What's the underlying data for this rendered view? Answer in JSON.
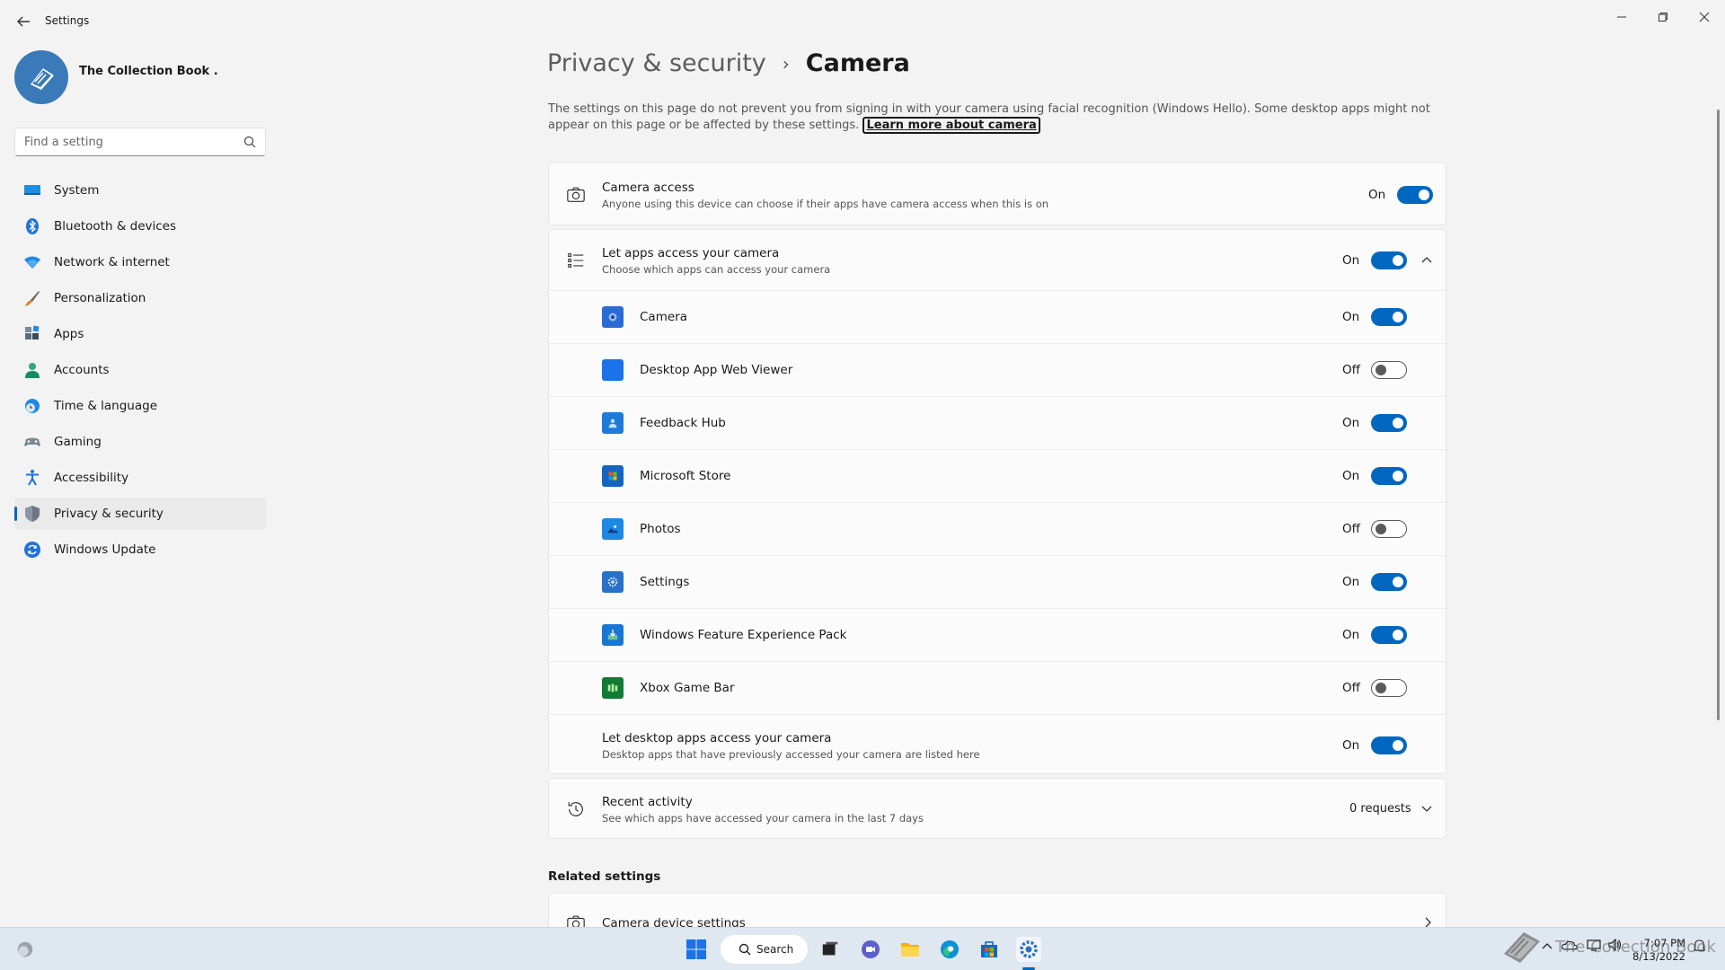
{
  "window": {
    "title": "Settings"
  },
  "profile": {
    "name": "The Collection Book ."
  },
  "search": {
    "placeholder": "Find a setting"
  },
  "sidebar": {
    "items": [
      {
        "label": "System",
        "icon": "monitor-icon"
      },
      {
        "label": "Bluetooth & devices",
        "icon": "bluetooth-icon"
      },
      {
        "label": "Network & internet",
        "icon": "wifi-icon"
      },
      {
        "label": "Personalization",
        "icon": "brush-icon"
      },
      {
        "label": "Apps",
        "icon": "apps-icon"
      },
      {
        "label": "Accounts",
        "icon": "person-icon"
      },
      {
        "label": "Time & language",
        "icon": "globe-clock-icon"
      },
      {
        "label": "Gaming",
        "icon": "gamepad-icon"
      },
      {
        "label": "Accessibility",
        "icon": "accessibility-icon"
      },
      {
        "label": "Privacy & security",
        "icon": "shield-icon",
        "active": true
      },
      {
        "label": "Windows Update",
        "icon": "update-icon"
      }
    ]
  },
  "header": {
    "parent": "Privacy & security",
    "separator": "›",
    "current": "Camera"
  },
  "intro": {
    "text": "The settings on this page do not prevent you from signing in with your camera using facial recognition (Windows Hello). Some desktop apps might not appear on this page or be affected by these settings.",
    "link": "Learn more about camera"
  },
  "camera_access": {
    "title": "Camera access",
    "subtitle": "Anyone using this device can choose if their apps have camera access when this is on",
    "state": "On"
  },
  "apps_access": {
    "title": "Let apps access your camera",
    "subtitle": "Choose which apps can access your camera",
    "state": "On",
    "apps": [
      {
        "name": "Camera",
        "state": "On",
        "color": "#2b6bd6"
      },
      {
        "name": "Desktop App Web Viewer",
        "state": "Off",
        "color": "#1a73e8"
      },
      {
        "name": "Feedback Hub",
        "state": "On",
        "color": "#1e7ad8"
      },
      {
        "name": "Microsoft Store",
        "state": "On",
        "color": "#1565c0"
      },
      {
        "name": "Photos",
        "state": "Off",
        "color": "#1e88e5"
      },
      {
        "name": "Settings",
        "state": "On",
        "color": "#2872c9"
      },
      {
        "name": "Windows Feature Experience Pack",
        "state": "On",
        "color": "#1976d2"
      },
      {
        "name": "Xbox Game Bar",
        "state": "Off",
        "color": "#117a37"
      }
    ],
    "desktop": {
      "title": "Let desktop apps access your camera",
      "subtitle": "Desktop apps that have previously accessed your camera are listed here",
      "state": "On"
    }
  },
  "recent": {
    "title": "Recent activity",
    "subtitle": "See which apps have accessed your camera in the last 7 days",
    "value": "0 requests"
  },
  "related": {
    "heading": "Related settings",
    "item": "Camera device settings"
  },
  "taskbar": {
    "search_label": "Search",
    "time": "7:07 PM",
    "date": "8/13/2022",
    "watermark": "The Collection Book"
  },
  "colors": {
    "accent": "#0067c0",
    "background": "#f3f3f3",
    "card": "#fbfbfb"
  }
}
